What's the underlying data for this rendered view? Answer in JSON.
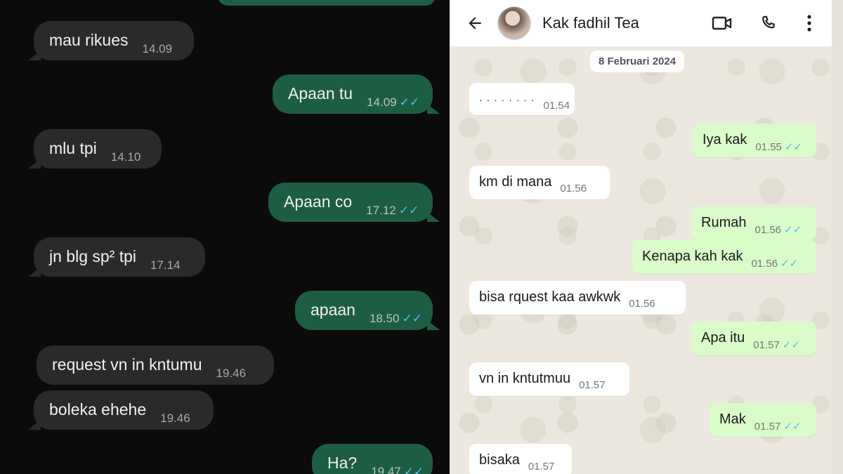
{
  "left_chat": {
    "messages": [
      {
        "dir": "in",
        "text": "mau rikues",
        "time": "14.09"
      },
      {
        "dir": "out",
        "text": "Apaan tu",
        "time": "14.09"
      },
      {
        "dir": "in",
        "text": "mlu tpi",
        "time": "14.10"
      },
      {
        "dir": "out",
        "text": "Apaan co",
        "time": "17.12"
      },
      {
        "dir": "in",
        "text": "jn blg sp² tpi",
        "time": "17.14"
      },
      {
        "dir": "out",
        "text": "apaan",
        "time": "18.50"
      },
      {
        "dir": "in",
        "text": "request vn in kntumu",
        "time": "19.46"
      },
      {
        "dir": "in",
        "text": "boleka ehehe",
        "time": "19.46"
      },
      {
        "dir": "out",
        "text": "Ha?",
        "time": "19.47"
      }
    ],
    "colors": {
      "background": "#0b0b0b",
      "incoming": "#2a2a2a",
      "outgoing": "#1d5d43",
      "read_ticks": "#53bdeb"
    }
  },
  "right_chat": {
    "header": {
      "contact_name": "Kak fadhil Tea",
      "back_icon": "arrow-left-icon",
      "video_icon": "video-camera-icon",
      "call_icon": "phone-icon",
      "menu_icon": "more-vertical-icon"
    },
    "date_chip": "8 Februari 2024",
    "messages": [
      {
        "dir": "in",
        "text": "· · · ·  · · · ·",
        "time": "01.54"
      },
      {
        "dir": "out",
        "text": "Iya kak",
        "time": "01.55"
      },
      {
        "dir": "in",
        "text": "km di mana",
        "time": "01.56"
      },
      {
        "dir": "out",
        "text": "Rumah",
        "time": "01.56"
      },
      {
        "dir": "out",
        "text": "Kenapa kah kak",
        "time": "01.56"
      },
      {
        "dir": "in",
        "text": "bisa rquest kaa awkwk",
        "time": "01.56"
      },
      {
        "dir": "out",
        "text": "Apa itu",
        "time": "01.57"
      },
      {
        "dir": "in",
        "text": "vn in kntutmuu",
        "time": "01.57"
      },
      {
        "dir": "out",
        "text": "Mak",
        "time": "01.57"
      },
      {
        "dir": "in",
        "text": "bisaka",
        "time": "01.57"
      }
    ],
    "colors": {
      "background": "#ece8df",
      "incoming": "#ffffff",
      "outgoing": "#dafcc9",
      "read_ticks": "#53bdeb"
    }
  },
  "ticks_glyph": "✓✓"
}
